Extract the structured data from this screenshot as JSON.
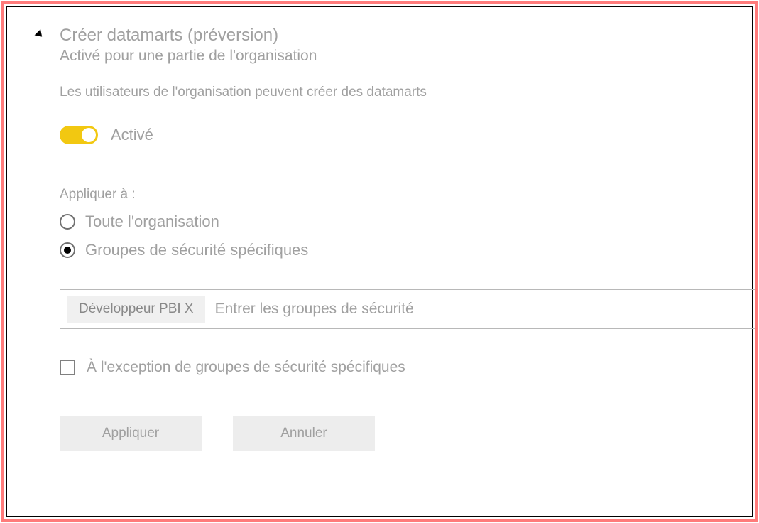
{
  "setting": {
    "title": "Créer datamarts (préversion)",
    "subtitle": "Activé pour une partie de l'organisation",
    "description": "Les utilisateurs de l'organisation peuvent créer des datamarts",
    "toggle_label": "Activé",
    "toggle_state": "on"
  },
  "apply": {
    "label": "Appliquer à :",
    "options": [
      {
        "label": "Toute l'organisation",
        "selected": false
      },
      {
        "label": "Groupes de sécurité spécifiques",
        "selected": true
      }
    ]
  },
  "groups": {
    "chip": "Développeur PBI X",
    "placeholder": "Entrer les groupes de sécurité"
  },
  "except": {
    "label": "À l'exception de groupes de sécurité spécifiques",
    "checked": false
  },
  "buttons": {
    "apply": "Appliquer",
    "cancel": "Annuler"
  },
  "colors": {
    "accent": "#f2c811",
    "frame": "#ff7b7b"
  }
}
